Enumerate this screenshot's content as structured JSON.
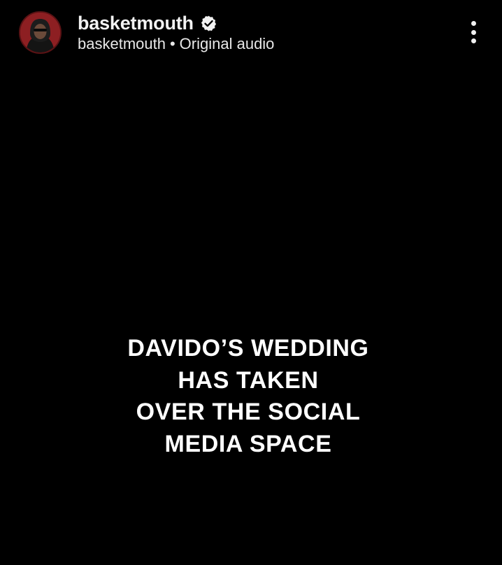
{
  "post_header": {
    "username": "basketmouth",
    "verified": true,
    "audio_owner": "basketmouth",
    "separator": "•",
    "audio_label": "Original audio",
    "avatar_icon": "profile-avatar-icon",
    "verified_icon": "verified-badge-icon",
    "more_icon": "more-options-vertical-icon"
  },
  "video_overlay": {
    "lines": [
      "DAVIDO’S WEDDING",
      "HAS TAKEN",
      "OVER THE SOCIAL",
      "MEDIA SPACE"
    ]
  },
  "colors": {
    "background": "#000000",
    "text": "#ffffff",
    "avatar_ring": "#8d1f22"
  }
}
